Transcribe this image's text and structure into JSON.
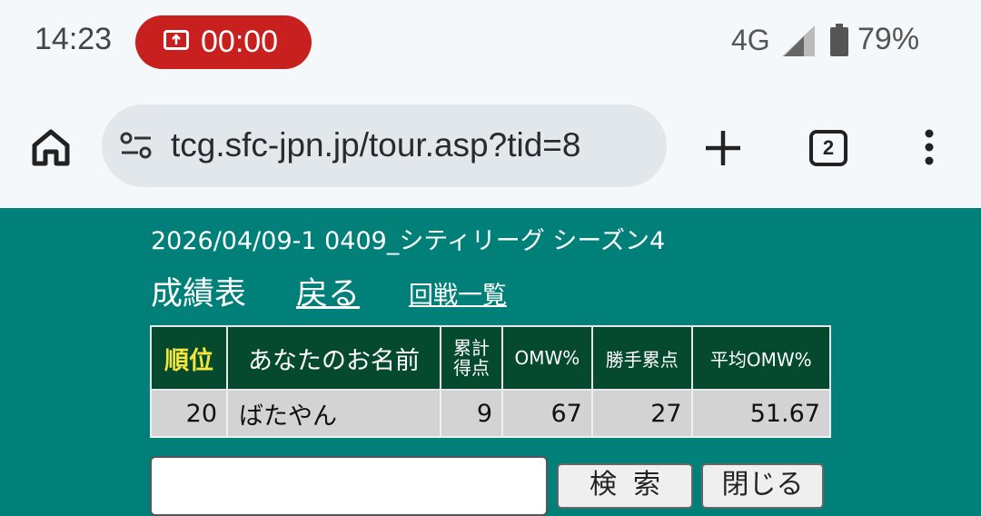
{
  "status_bar": {
    "time": "14:23",
    "recording_timer": "00:00",
    "network": "4G",
    "battery": "79%",
    "recording_color": "#c8201e"
  },
  "browser": {
    "url": "tcg.sfc-jpn.jp/tour.asp?tid=8",
    "tab_count": "2",
    "icons": [
      "home-icon",
      "site-settings-icon",
      "new-tab-icon",
      "tabs-icon",
      "overflow-menu-icon"
    ]
  },
  "page": {
    "background": "#008079",
    "subtitle": "2026/04/09-1 0409_シティリーグ シーズン4",
    "nav": {
      "title": "成績表",
      "back": "戻る",
      "rounds": "回戦一覧"
    },
    "table": {
      "headers": {
        "rank": "順位",
        "name": "あなたのお名前",
        "points_line1": "累計",
        "points_line2": "得点",
        "omw": "OMW%",
        "opp_points": "勝手累点",
        "avg_omw": "平均OMW%"
      },
      "row": {
        "rank": "20",
        "name": "ばたやん",
        "points": "9",
        "omw": "67",
        "opp_points": "27",
        "avg_omw": "51.67"
      }
    },
    "search": {
      "input_value": "",
      "search_button": "検索",
      "close_button": "閉じる"
    }
  }
}
